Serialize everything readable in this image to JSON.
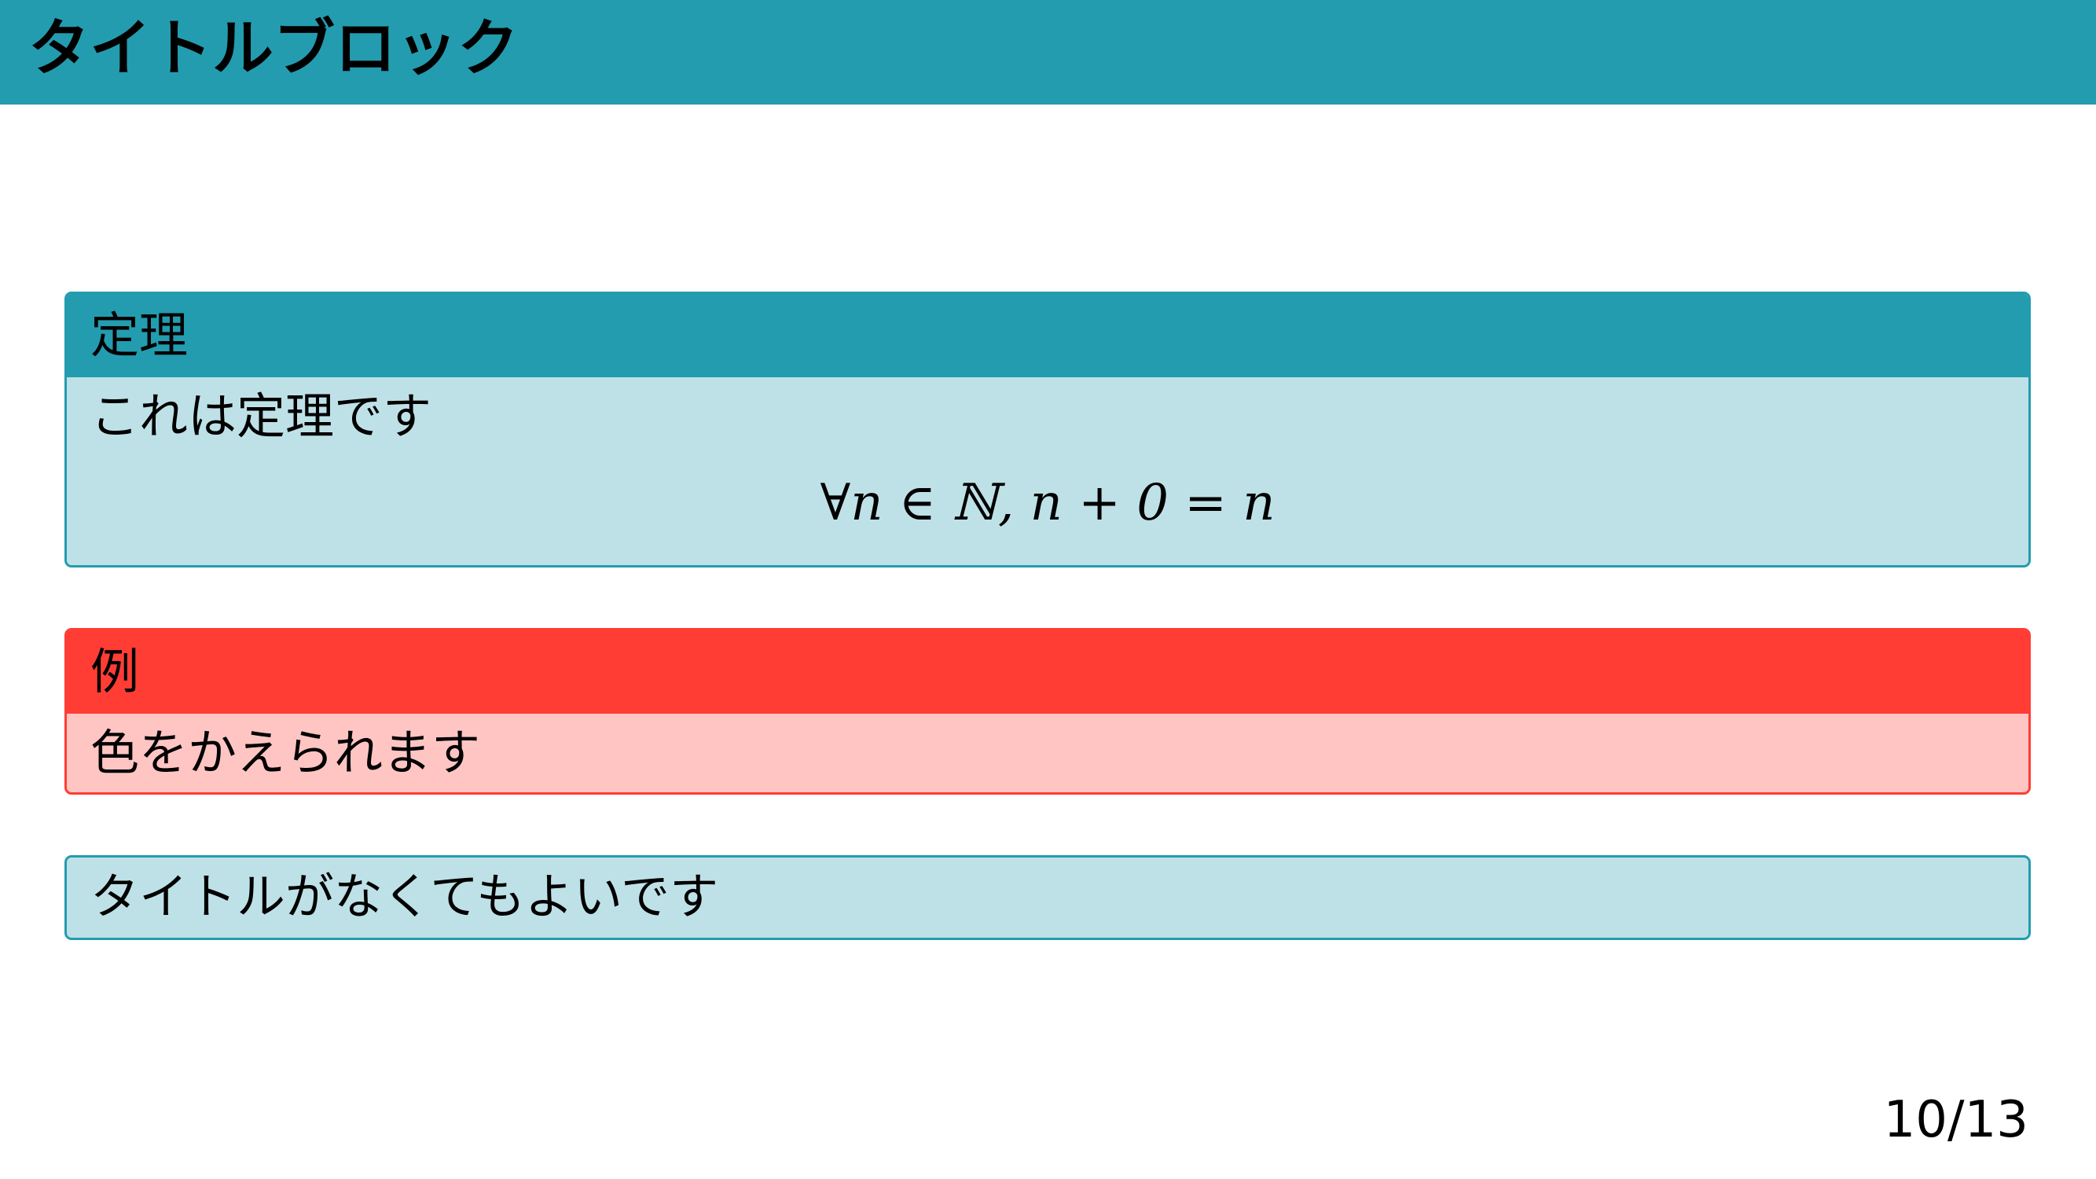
{
  "header": {
    "title": "タイトルブロック"
  },
  "blocks": {
    "theorem": {
      "title": "定理",
      "text": "これは定理です",
      "formula": "∀n ∈ ℕ, n + 0 = n"
    },
    "example": {
      "title": "例",
      "text": "色をかえられます"
    },
    "untitled": {
      "text": "タイトルがなくてもよいです"
    }
  },
  "footer": {
    "page_number": "10/13"
  },
  "colors": {
    "header_bar": "#239CAF",
    "theorem_title_bg": "#239CAF",
    "theorem_body_bg": "#BEE1E7",
    "example_title_bg": "#FF3D35",
    "example_body_bg": "#FFC5C3"
  }
}
